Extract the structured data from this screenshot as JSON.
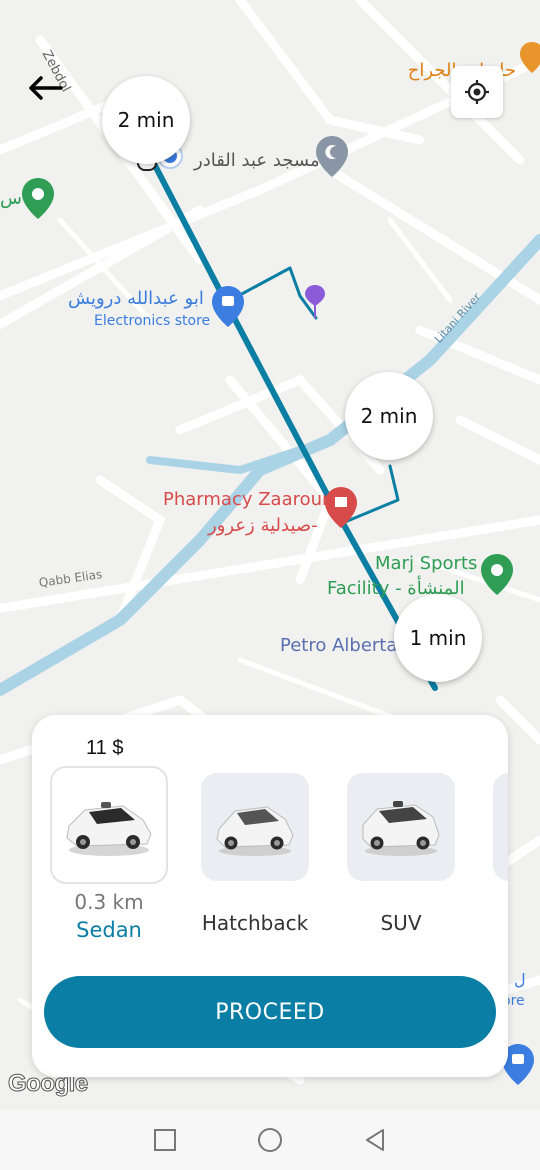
{
  "header": {
    "back_icon": "arrow-left-icon",
    "locate_icon": "my-location-icon"
  },
  "map": {
    "labels": {
      "zebdol": "Zebdol",
      "jarrah": "حلويات الجراح",
      "mosque": "مسجد عبد القادر",
      "left_cut": "س",
      "store_ar": "ابو عبدالله درويش",
      "store_en": "Electronics store",
      "river": "Litani River",
      "pharmacy_en": "Pharmacy Zaarour",
      "pharmacy_ar": "صيدلية زعرور-",
      "marj1": "Marj Sports",
      "marj2": "Facility - المنشأة",
      "qabb": "Qabb Elias",
      "petro": "Petro Alberta",
      "right_cut1": "ل للـ",
      "right_cut2": "ore",
      "google": "Google"
    },
    "eta": {
      "start": "2 min",
      "middle": "2 min",
      "end": "1 min"
    },
    "colors": {
      "route": "#0b7fa3",
      "river": "#aad3e6",
      "pin_green": "#2f9e54",
      "pin_blue": "#3b7de0",
      "pin_red": "#d84b4b",
      "pin_purple": "#8c5bd9"
    }
  },
  "ride_panel": {
    "price": "11 $",
    "distance": "0.3 km",
    "vehicles": [
      {
        "name": "Sedan",
        "selected": true
      },
      {
        "name": "Hatchback",
        "selected": false
      },
      {
        "name": "SUV",
        "selected": false
      }
    ],
    "proceed_label": "PROCEED",
    "accent": "#0a7ea4"
  },
  "system_nav": {
    "icons": [
      "recents-square-icon",
      "home-circle-icon",
      "back-triangle-icon"
    ]
  }
}
